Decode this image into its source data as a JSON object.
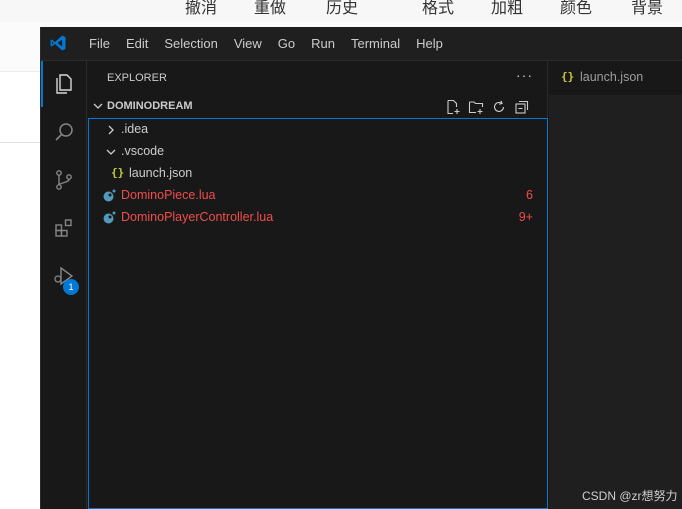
{
  "background_app": {
    "toolbar_items": [
      "撤消",
      "重做",
      "历史",
      "格式",
      "加粗",
      "颜色",
      "背景"
    ]
  },
  "titlebar": {
    "menu": [
      "File",
      "Edit",
      "Selection",
      "View",
      "Go",
      "Run",
      "Terminal",
      "Help"
    ]
  },
  "activity_bar": {
    "items": [
      "files-icon",
      "search-icon",
      "source-control-icon",
      "extensions-icon",
      "run-debug-icon"
    ],
    "run_debug_badge": "1",
    "accent": "#0078d4"
  },
  "explorer": {
    "title": "EXPLORER",
    "more": "···",
    "section_title": "DOMINODREAM",
    "tree": [
      {
        "label": ".idea",
        "type": "folder",
        "expanded": false
      },
      {
        "label": ".vscode",
        "type": "folder",
        "expanded": true
      },
      {
        "label": "launch.json",
        "type": "json",
        "icon": "{}"
      },
      {
        "label": "DominoPiece.lua",
        "type": "lua",
        "problems": "6"
      },
      {
        "label": "DominoPlayerController.lua",
        "type": "lua",
        "problems": "9+"
      }
    ],
    "error_color": "#f14c4c"
  },
  "editor": {
    "tab": {
      "icon": "{}",
      "label": "launch.json"
    }
  },
  "watermark": "CSDN @zr想努力"
}
